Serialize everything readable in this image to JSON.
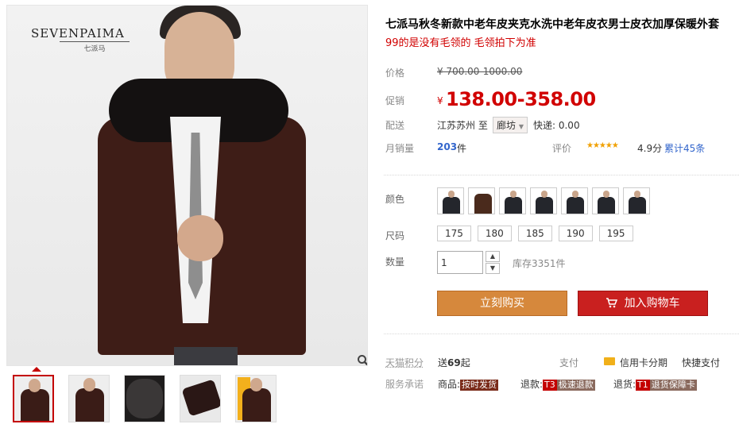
{
  "gallery": {
    "brand": "SEVENPAIMA",
    "brand_sub": "七派马",
    "zoom_icon": "magnifier-icon",
    "thumbnails": [
      "front-model",
      "front-model-alt",
      "fur-collar",
      "sleeve-detail",
      "promo"
    ]
  },
  "product": {
    "title": "七派马秋冬新款中老年皮夹克水洗中老年皮衣男士皮衣加厚保暖外套",
    "subtitle": "99的是没有毛领的 毛领拍下为准"
  },
  "price": {
    "list_label": "价格",
    "list_price": "¥ 700.00-1000.00",
    "promo_label": "促销",
    "currency": "¥",
    "promo_price": "138.00-358.00"
  },
  "shipping": {
    "label": "配送",
    "from": "江苏苏州 至",
    "destination": "廊坊",
    "fee": "快递: 0.00"
  },
  "sales": {
    "label": "月销量",
    "count": "203",
    "unit": "件",
    "rating_label": "评价",
    "stars": "★★★★★",
    "score": "4.9分",
    "reviews": "累计45条"
  },
  "sku": {
    "color_label": "颜色",
    "size_label": "尺码",
    "sizes": [
      "175",
      "180",
      "185",
      "190",
      "195"
    ],
    "qty_label": "数量",
    "qty_value": "1",
    "stock": "库存3351件"
  },
  "actions": {
    "buy_now": "立刻购买",
    "add_to_cart": "加入购物车",
    "cart_icon": "cart-icon"
  },
  "extras": {
    "points_label": "天猫积分",
    "points_prefix": "送",
    "points_value": "69",
    "points_suffix": "起",
    "pay_label": "支付",
    "credit": "信用卡分期",
    "quickpay": "快捷支付",
    "service_label": "服务承诺",
    "goods_label": "商品:",
    "goods_tag": "按时发货",
    "refund_label": "退款:",
    "refund_code": "T3",
    "refund_tag": "极速退款",
    "return_label": "退货:",
    "return_code": "T1",
    "return_tag": "退货保障卡"
  },
  "colors": {
    "accent_red": "#c40000",
    "buy_orange": "#d6883c",
    "cart_red": "#c9201f",
    "link_blue": "#3366cc"
  }
}
